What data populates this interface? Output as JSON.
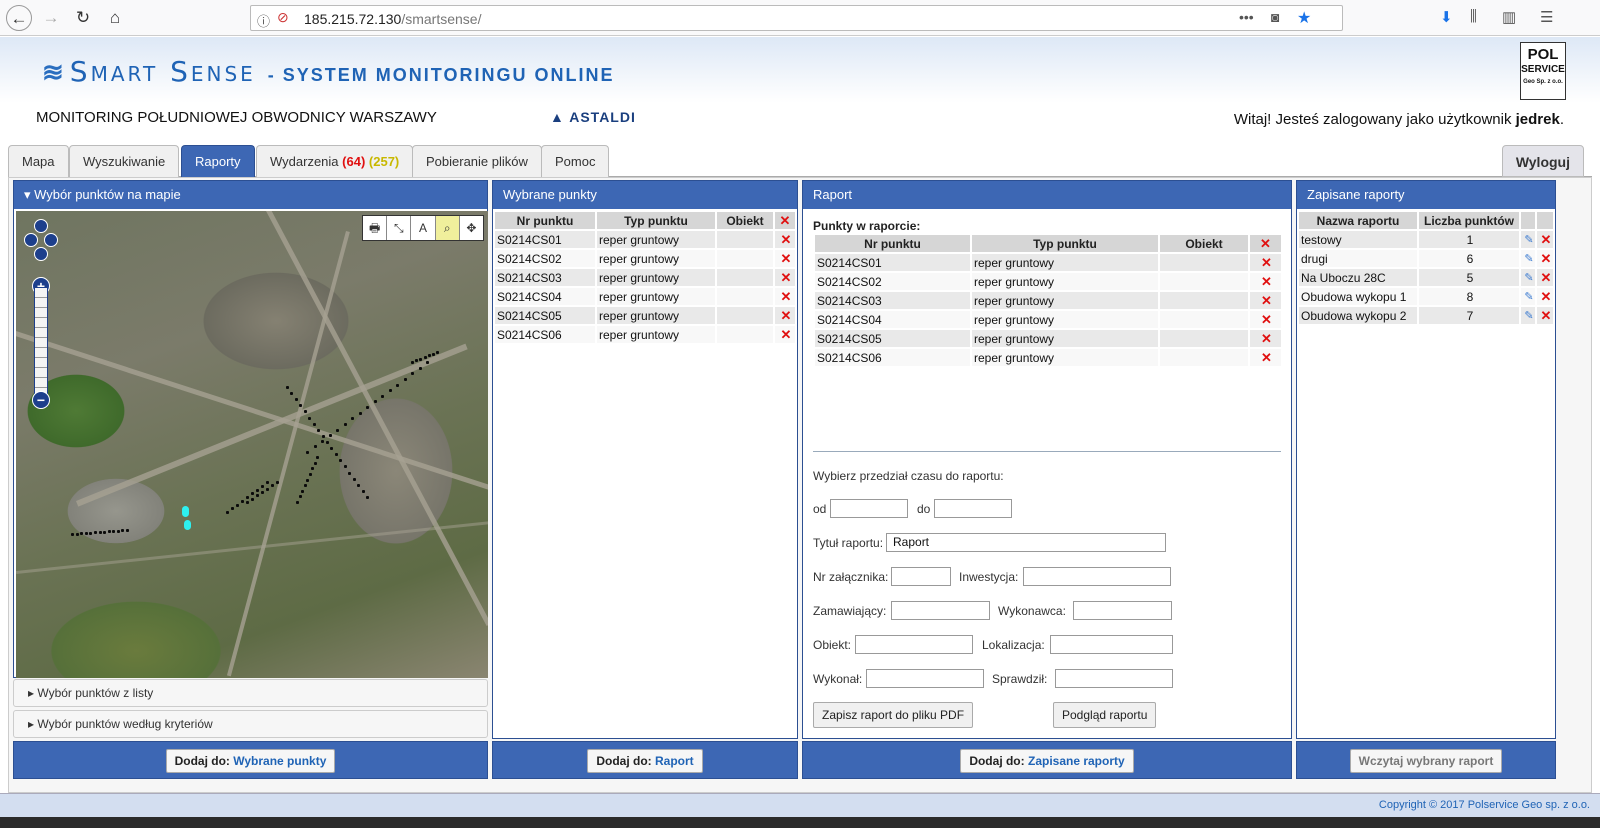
{
  "browser": {
    "url_host": "185.215.72.130",
    "url_path": "/smartsense/",
    "menu_dots": "•••"
  },
  "header": {
    "brand": "Smart Sense",
    "subtitle": "- SYSTEM MONITORINGU ONLINE",
    "project": "MONITORING POŁUDNIOWEJ OBWODNICY WARSZAWY",
    "partner_logo": "ASTALDI",
    "partner_logo_mark": "▲",
    "polservice_logo": [
      "POL",
      "SERVICE",
      "Geo Sp. z o.o."
    ],
    "welcome_prefix": "Witaj! Jesteś zalogowany jako użytkownik ",
    "welcome_user": "jedrek",
    "welcome_suffix": "."
  },
  "tabs": [
    {
      "label": "Mapa"
    },
    {
      "label": "Wyszukiwanie"
    },
    {
      "label": "Raporty",
      "active": true
    },
    {
      "label": "Wydarzenia",
      "count_red": "(64)",
      "count_yellow": "(257)"
    },
    {
      "label": "Pobieranie plików"
    },
    {
      "label": "Pomoc"
    }
  ],
  "logout": "Wyloguj",
  "map_panel": {
    "title": "▾ Wybór punktów na mapie",
    "acc1": "▸ Wybór punktów z listy",
    "acc2": "▸ Wybór punktów według kryteriów",
    "tools": [
      "🖶",
      "⤡",
      "A",
      "⌕",
      "✥"
    ],
    "zoom_in": "+",
    "zoom_out": "−"
  },
  "selected_panel": {
    "title": "Wybrane punkty",
    "headers": [
      "Nr punktu",
      "Typ punktu",
      "Obiekt"
    ],
    "rows": [
      {
        "nr": "S0214CS01",
        "typ": "reper gruntowy",
        "obiekt": ""
      },
      {
        "nr": "S0214CS02",
        "typ": "reper gruntowy",
        "obiekt": ""
      },
      {
        "nr": "S0214CS03",
        "typ": "reper gruntowy",
        "obiekt": ""
      },
      {
        "nr": "S0214CS04",
        "typ": "reper gruntowy",
        "obiekt": ""
      },
      {
        "nr": "S0214CS05",
        "typ": "reper gruntowy",
        "obiekt": ""
      },
      {
        "nr": "S0214CS06",
        "typ": "reper gruntowy",
        "obiekt": ""
      }
    ]
  },
  "report_panel": {
    "title": "Raport",
    "points_label": "Punkty w raporcie:",
    "headers": [
      "Nr punktu",
      "Typ punktu",
      "Obiekt"
    ],
    "rows": [
      {
        "nr": "S0214CS01",
        "typ": "reper gruntowy",
        "obiekt": ""
      },
      {
        "nr": "S0214CS02",
        "typ": "reper gruntowy",
        "obiekt": ""
      },
      {
        "nr": "S0214CS03",
        "typ": "reper gruntowy",
        "obiekt": ""
      },
      {
        "nr": "S0214CS04",
        "typ": "reper gruntowy",
        "obiekt": ""
      },
      {
        "nr": "S0214CS05",
        "typ": "reper gruntowy",
        "obiekt": ""
      },
      {
        "nr": "S0214CS06",
        "typ": "reper gruntowy",
        "obiekt": ""
      }
    ],
    "time_label": "Wybierz przedział czasu do raportu:",
    "from_label": "od",
    "to_label": "do",
    "title_label": "Tytuł raportu:",
    "title_value": "Raport",
    "nr_zal_label": "Nr załącznika:",
    "inwestycja_label": "Inwestycja:",
    "zamawiajacy_label": "Zamawiający:",
    "wykonawca_label": "Wykonawca:",
    "obiekt_label": "Obiekt:",
    "lokalizacja_label": "Lokalizacja:",
    "wykonal_label": "Wykonał:",
    "sprawdzil_label": "Sprawdził:",
    "save_pdf": "Zapisz raport do pliku PDF",
    "preview": "Podgląd raportu"
  },
  "saved_panel": {
    "title": "Zapisane raporty",
    "headers": [
      "Nazwa raportu",
      "Liczba punktów"
    ],
    "rows": [
      {
        "name": "testowy",
        "count": "1"
      },
      {
        "name": "drugi",
        "count": "6"
      },
      {
        "name": "Na Uboczu 28C",
        "count": "5"
      },
      {
        "name": "Obudowa wykopu 1",
        "count": "8"
      },
      {
        "name": "Obudowa wykopu 2",
        "count": "7"
      }
    ]
  },
  "footers": {
    "add_prefix": "Dodaj do:",
    "add_selected": "Wybrane punkty",
    "add_report": "Raport",
    "add_saved": "Zapisane raporty",
    "load": "Wczytaj wybrany raport"
  },
  "delete_glyph": "✕",
  "edit_glyph": "✎",
  "copyright": "Copyright © 2017 Polservice Geo sp. z o.o."
}
